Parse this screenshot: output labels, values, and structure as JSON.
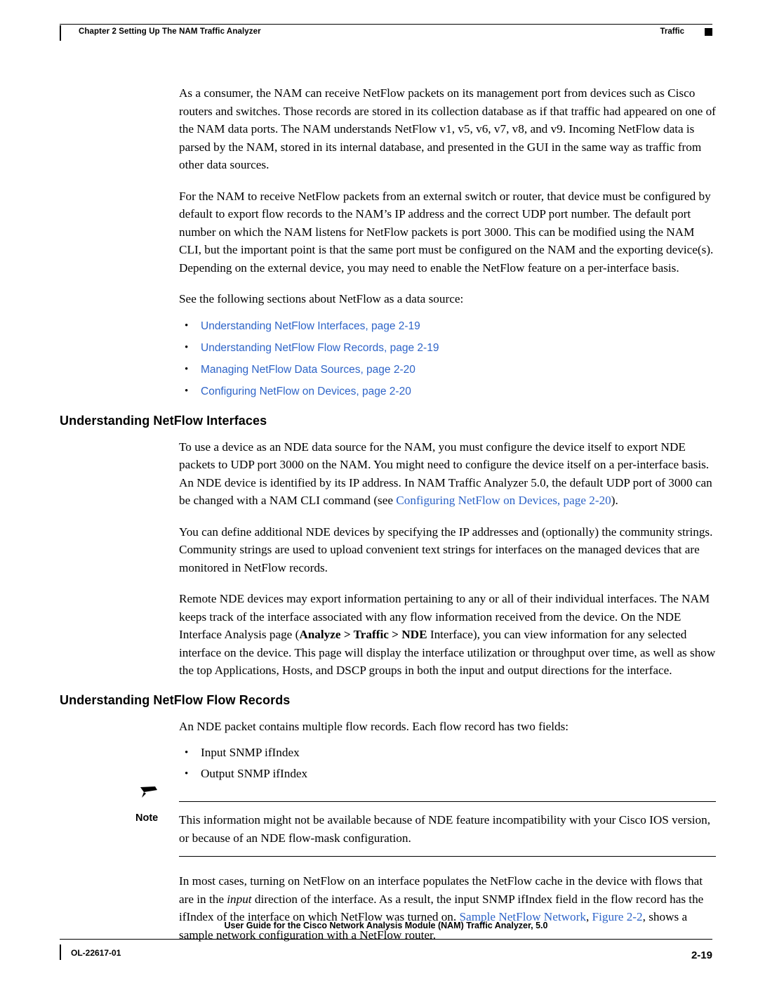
{
  "header": {
    "chapter": "Chapter 2      Setting Up The NAM Traffic Analyzer",
    "right_label": "Traffic"
  },
  "paragraphs": {
    "p1": "As a consumer, the NAM can receive NetFlow packets on its management port from devices such as Cisco routers and switches. Those records are stored in its collection database as if that traffic had appeared on one of the NAM data ports. The NAM understands NetFlow v1, v5, v6, v7, v8, and v9. Incoming NetFlow data is parsed by the NAM, stored in its internal database, and presented in the GUI in the same way as traffic from other data sources.",
    "p2": "For the NAM to receive NetFlow packets from an external switch or router, that device must be configured by default to export flow records to the NAM’s IP address and the correct UDP port number. The default port number on which the NAM listens for NetFlow packets is port 3000. This can be modified using the NAM CLI, but the important point is that the same port must be configured on the NAM and the exporting device(s). Depending on the external device, you may need to enable the NetFlow feature on a per-interface basis.",
    "p3": "See the following sections about NetFlow as a data source:"
  },
  "links": [
    {
      "label": "Understanding NetFlow Interfaces, page 2-19"
    },
    {
      "label": "Understanding NetFlow Flow Records, page 2-19"
    },
    {
      "label": "Managing NetFlow Data Sources, page 2-20"
    },
    {
      "label": "Configuring NetFlow on Devices, page 2-20"
    }
  ],
  "section1": {
    "heading": "Understanding NetFlow Interfaces",
    "p1_before": "To use a device as an NDE data source for the NAM, you must configure the device itself to export NDE packets to UDP port 3000 on the NAM. You might need to configure the device itself on a per-interface basis. An NDE device is identified by its IP address. In NAM Traffic Analyzer 5.0, the default UDP port of 3000 can be changed with a NAM CLI command (see ",
    "p1_link": "Configuring NetFlow on Devices, page 2-20",
    "p1_after": ").",
    "p2": "You can define additional NDE devices by specifying the IP addresses and (optionally) the community strings. Community strings are used to upload convenient text strings for interfaces on the managed devices that are monitored in NetFlow records.",
    "p3_a": "Remote NDE devices may export information pertaining to any or all of their individual interfaces. The NAM keeps track of the interface associated with any flow information received from the device. On the NDE Interface Analysis page (",
    "p3_bold1": "Analyze > Traffic > NDE",
    "p3_b": " Interface), you can view information for any selected interface on the device. This page will display the interface utilization or throughput over time, as well as show the top Applications, Hosts, and DSCP groups in both the input and output directions for the interface."
  },
  "section2": {
    "heading": "Understanding NetFlow Flow Records",
    "p1": "An NDE packet contains multiple flow records. Each flow record has two fields:",
    "bullets": [
      "Input SNMP ifIndex",
      "Output SNMP ifIndex"
    ]
  },
  "note": {
    "label": "Note",
    "text": "This information might not be available because of NDE feature incompatibility with your Cisco IOS version, or because of an NDE flow-mask configuration."
  },
  "closing": {
    "a": "In most cases, turning on NetFlow on an interface populates the NetFlow cache in the device with flows that are in the ",
    "italic": "input",
    "b": " direction of the interface. As a result, the input SNMP ifIndex field in the flow record has the ifIndex of the interface on which NetFlow was turned on. ",
    "link1": "Sample NetFlow Network",
    "sep": ", ",
    "link2": "Figure 2-2",
    "c": ", shows a sample network configuration with a NetFlow router."
  },
  "footer": {
    "title": "User Guide for the Cisco Network Analysis Module (NAM) Traffic Analyzer, 5.0",
    "doc_id": "OL-22617-01",
    "page_number": "2-19"
  },
  "colors": {
    "link": "#2e64c8",
    "text": "#000000",
    "background": "#ffffff"
  }
}
